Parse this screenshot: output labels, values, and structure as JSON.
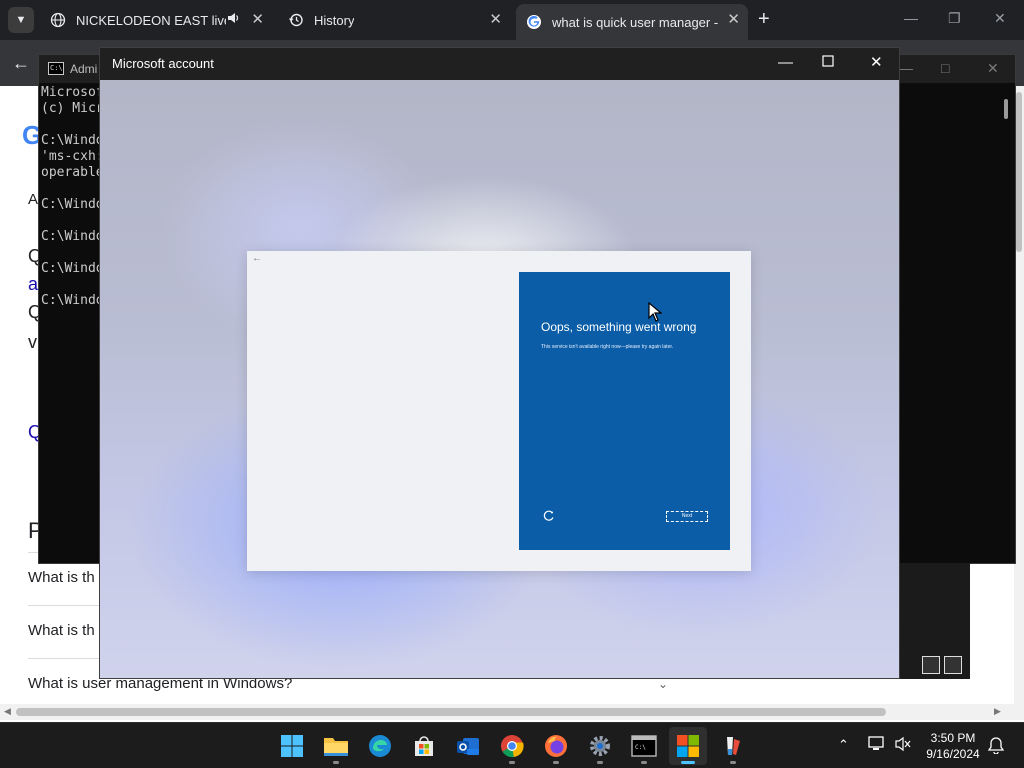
{
  "browser": {
    "tabs": [
      {
        "title": "NICKELODEON EAST live str",
        "icon": "globe-icon",
        "audio": true
      },
      {
        "title": "History",
        "icon": "history-icon"
      },
      {
        "title": "what is quick user manager - G",
        "icon": "google-icon",
        "active": true
      }
    ],
    "page": {
      "fragments": {
        "g": "G",
        "a": "A",
        "q1": "Q",
        "a2": "a",
        "q2": "Q",
        "v": "v",
        "q3": "Q",
        "p": "P"
      },
      "faq": [
        "What is th",
        "What is th",
        "What is user management in Windows?"
      ]
    }
  },
  "terminal": {
    "title": "Admi",
    "lines": [
      "Microsof",
      "(c) Micr",
      "",
      "C:\\Windo",
      "'ms-cxh:",
      "operable",
      "",
      "C:\\Windo",
      "",
      "C:\\Windo",
      "",
      "C:\\Windo",
      "",
      "C:\\Windo"
    ]
  },
  "dialog": {
    "title": "Microsoft account",
    "heading": "Oops, something went wrong",
    "message": "This service isn't available right now—please try again later.",
    "next_label": "Next"
  },
  "taskbar": {
    "apps": [
      "start-icon",
      "file-explorer-icon",
      "edge-icon",
      "store-icon",
      "outlook-new-icon",
      "chrome-icon",
      "firefox-icon",
      "settings-icon",
      "terminal-icon",
      "microsoft-icon",
      "paint-icon"
    ],
    "time": "3:50 PM",
    "date": "9/16/2024"
  },
  "colors": {
    "oobe_blue": "#0a5da6",
    "accent": "#4cc2ff"
  }
}
